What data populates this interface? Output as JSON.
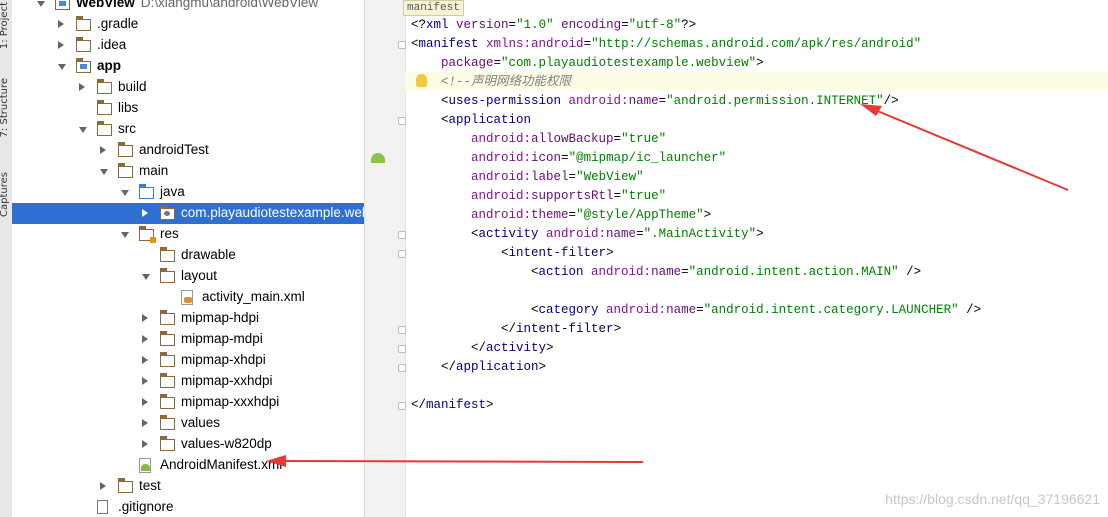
{
  "side_tabs": [
    "1: Project",
    "7: Structure",
    "Captures"
  ],
  "project_tree": [
    {
      "label": "WebView",
      "path": "D:\\xiangmu\\android\\WebView",
      "icon": "module-folder-icon",
      "arrow": "down",
      "level": 0,
      "bold": true
    },
    {
      "label": ".gradle",
      "icon": "folder-icon",
      "arrow": "right",
      "level": 1
    },
    {
      "label": ".idea",
      "icon": "folder-icon",
      "arrow": "right",
      "level": 1
    },
    {
      "label": "app",
      "icon": "module-folder-icon",
      "arrow": "down",
      "level": 1,
      "bold": true
    },
    {
      "label": "build",
      "icon": "folder-icon",
      "arrow": "right",
      "level": 2
    },
    {
      "label": "libs",
      "icon": "folder-icon",
      "arrow": "none",
      "level": 2
    },
    {
      "label": "src",
      "icon": "folder-icon",
      "arrow": "down",
      "level": 2
    },
    {
      "label": "androidTest",
      "icon": "folder-icon",
      "arrow": "right",
      "level": 3
    },
    {
      "label": "main",
      "icon": "folder-icon",
      "arrow": "down",
      "level": 3
    },
    {
      "label": "java",
      "icon": "source-folder-icon",
      "arrow": "down",
      "level": 4
    },
    {
      "label": "com.playaudiotestexample.webview",
      "icon": "package-icon",
      "arrow": "right",
      "level": 5,
      "selected": true
    },
    {
      "label": "res",
      "icon": "resource-folder-icon",
      "arrow": "down",
      "level": 4
    },
    {
      "label": "drawable",
      "icon": "folder-icon",
      "arrow": "none",
      "level": 5
    },
    {
      "label": "layout",
      "icon": "folder-icon",
      "arrow": "down",
      "level": 5
    },
    {
      "label": "activity_main.xml",
      "icon": "xml-file-icon",
      "arrow": "none",
      "level": 6
    },
    {
      "label": "mipmap-hdpi",
      "icon": "folder-icon",
      "arrow": "right",
      "level": 5
    },
    {
      "label": "mipmap-mdpi",
      "icon": "folder-icon",
      "arrow": "right",
      "level": 5
    },
    {
      "label": "mipmap-xhdpi",
      "icon": "folder-icon",
      "arrow": "right",
      "level": 5
    },
    {
      "label": "mipmap-xxhdpi",
      "icon": "folder-icon",
      "arrow": "right",
      "level": 5
    },
    {
      "label": "mipmap-xxxhdpi",
      "icon": "folder-icon",
      "arrow": "right",
      "level": 5
    },
    {
      "label": "values",
      "icon": "folder-icon",
      "arrow": "right",
      "level": 5
    },
    {
      "label": "values-w820dp",
      "icon": "folder-icon",
      "arrow": "right",
      "level": 5
    },
    {
      "label": "AndroidManifest.xml",
      "icon": "manifest-file-icon",
      "arrow": "none",
      "level": 4
    },
    {
      "label": "test",
      "icon": "folder-icon",
      "arrow": "right",
      "level": 3
    },
    {
      "label": ".gitignore",
      "icon": "text-file-icon",
      "arrow": "none",
      "level": 2
    }
  ],
  "editor": {
    "breadcrumb_tag": "manifest",
    "lines": [
      [
        [
          "t-br",
          "<?"
        ],
        [
          "t-tag",
          "xml "
        ],
        [
          "t-attr",
          "version"
        ],
        [
          "t-br",
          "="
        ],
        [
          "t-val",
          "\"1.0\" "
        ],
        [
          "t-attr",
          "encoding"
        ],
        [
          "t-br",
          "="
        ],
        [
          "t-val",
          "\"utf-8\""
        ],
        [
          "t-br",
          "?>"
        ]
      ],
      [
        [
          "t-br",
          "<"
        ],
        [
          "t-tag",
          "manifest "
        ],
        [
          "t-ns",
          "xmlns:android"
        ],
        [
          "t-br",
          "="
        ],
        [
          "t-val",
          "\"http://schemas.android.com/apk/res/android\""
        ]
      ],
      [
        [
          "t-br",
          "    "
        ],
        [
          "t-attr",
          "package"
        ],
        [
          "t-br",
          "="
        ],
        [
          "t-val",
          "\"com.playaudiotestexample.webview\""
        ],
        [
          "t-br",
          ">"
        ]
      ],
      [
        [
          "t-br",
          "    "
        ],
        [
          "t-com",
          "<!--声明网络功能权限"
        ]
      ],
      [
        [
          "t-br",
          "    <"
        ],
        [
          "t-tag",
          "uses-permission "
        ],
        [
          "t-ns",
          "android:"
        ],
        [
          "t-attr",
          "name"
        ],
        [
          "t-br",
          "="
        ],
        [
          "t-val",
          "\"android.permission.INTERNET\""
        ],
        [
          "t-br",
          "/>"
        ]
      ],
      [
        [
          "t-br",
          "    <"
        ],
        [
          "t-tag",
          "application"
        ]
      ],
      [
        [
          "t-br",
          "        "
        ],
        [
          "t-ns",
          "android:"
        ],
        [
          "t-attr",
          "allowBackup"
        ],
        [
          "t-br",
          "="
        ],
        [
          "t-val",
          "\"true\""
        ]
      ],
      [
        [
          "t-br",
          "        "
        ],
        [
          "t-ns",
          "android:"
        ],
        [
          "t-attr",
          "icon"
        ],
        [
          "t-br",
          "="
        ],
        [
          "t-val",
          "\"@mipmap/ic_launcher\""
        ]
      ],
      [
        [
          "t-br",
          "        "
        ],
        [
          "t-ns",
          "android:"
        ],
        [
          "t-attr",
          "label"
        ],
        [
          "t-br",
          "="
        ],
        [
          "t-val",
          "\"WebView\""
        ]
      ],
      [
        [
          "t-br",
          "        "
        ],
        [
          "t-ns",
          "android:"
        ],
        [
          "t-attr",
          "supportsRtl"
        ],
        [
          "t-br",
          "="
        ],
        [
          "t-val",
          "\"true\""
        ]
      ],
      [
        [
          "t-br",
          "        "
        ],
        [
          "t-ns",
          "android:"
        ],
        [
          "t-attr",
          "theme"
        ],
        [
          "t-br",
          "="
        ],
        [
          "t-val",
          "\"@style/AppTheme\""
        ],
        [
          "t-br",
          ">"
        ]
      ],
      [
        [
          "t-br",
          "        <"
        ],
        [
          "t-tag",
          "activity "
        ],
        [
          "t-ns",
          "android:"
        ],
        [
          "t-attr",
          "name"
        ],
        [
          "t-br",
          "="
        ],
        [
          "t-val",
          "\".MainActivity\""
        ],
        [
          "t-br",
          ">"
        ]
      ],
      [
        [
          "t-br",
          "            <"
        ],
        [
          "t-tag",
          "intent-filter"
        ],
        [
          "t-br",
          ">"
        ]
      ],
      [
        [
          "t-br",
          "                <"
        ],
        [
          "t-tag",
          "action "
        ],
        [
          "t-ns",
          "android:"
        ],
        [
          "t-attr",
          "name"
        ],
        [
          "t-br",
          "="
        ],
        [
          "t-val",
          "\"android.intent.action.MAIN\""
        ],
        [
          "t-br",
          " />"
        ]
      ],
      [],
      [
        [
          "t-br",
          "                <"
        ],
        [
          "t-tag",
          "category "
        ],
        [
          "t-ns",
          "android:"
        ],
        [
          "t-attr",
          "name"
        ],
        [
          "t-br",
          "="
        ],
        [
          "t-val",
          "\"android.intent.category.LAUNCHER\""
        ],
        [
          "t-br",
          " />"
        ]
      ],
      [
        [
          "t-br",
          "            </"
        ],
        [
          "t-tag",
          "intent-filter"
        ],
        [
          "t-br",
          ">"
        ]
      ],
      [
        [
          "t-br",
          "        </"
        ],
        [
          "t-tag",
          "activity"
        ],
        [
          "t-br",
          ">"
        ]
      ],
      [
        [
          "t-br",
          "    </"
        ],
        [
          "t-tag",
          "application"
        ],
        [
          "t-br",
          ">"
        ]
      ],
      [],
      [
        [
          "t-br",
          "</"
        ],
        [
          "t-tag",
          "manifest"
        ],
        [
          "t-br",
          ">"
        ]
      ]
    ]
  },
  "watermark": "https://blog.csdn.net/qq_37196621",
  "colors": {
    "selection": "#2f6fd1",
    "annotation_arrow": "#e53935"
  }
}
